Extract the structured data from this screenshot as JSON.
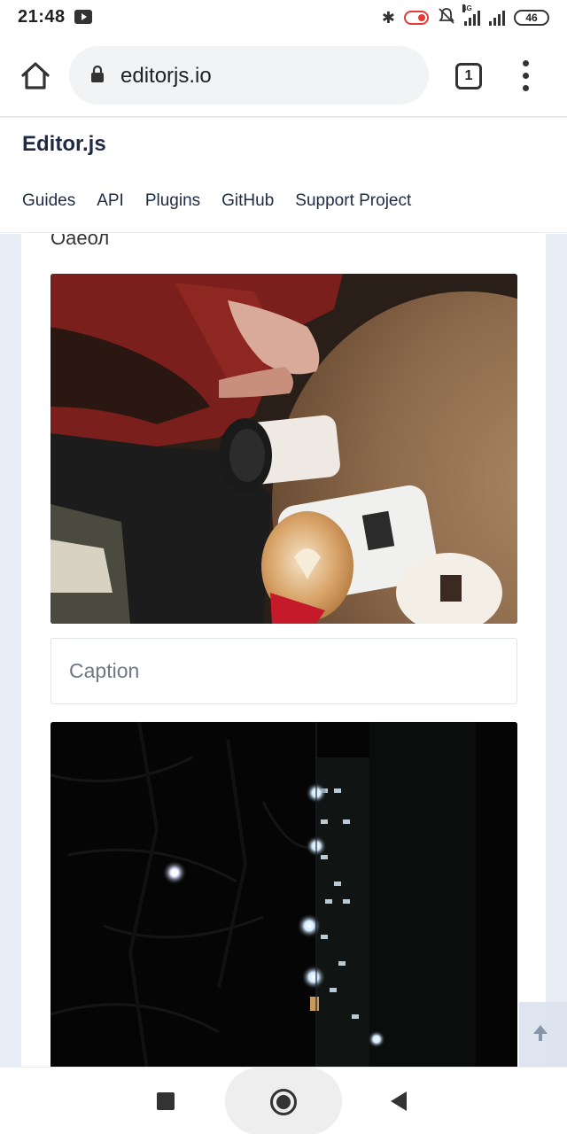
{
  "status_bar": {
    "time": "21:48",
    "network_label": "4G",
    "battery": "46"
  },
  "browser": {
    "url": "editorjs.io",
    "tab_count": "1"
  },
  "site": {
    "logo": "Editor.js",
    "nav": [
      "Guides",
      "API",
      "Plugins",
      "GitHub",
      "Support Project"
    ]
  },
  "editor": {
    "cut_off_text": "Оаеол",
    "caption_placeholder": "Caption"
  },
  "colors": {
    "brand_text": "#1f2a44",
    "page_background": "#e9edf5",
    "url_pill": "#f1f3f4"
  }
}
